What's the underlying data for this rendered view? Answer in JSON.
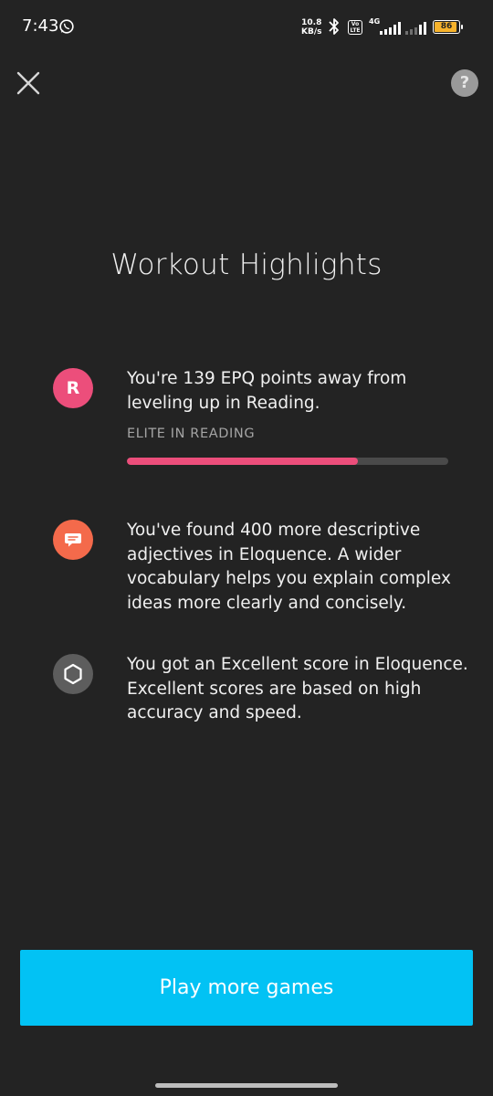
{
  "status_bar": {
    "time": "7:43",
    "net_speed_value": "10.8",
    "net_speed_unit": "KB/s",
    "network": "4G",
    "volte": "Vo LTE",
    "battery": "86",
    "icons": [
      "whatsapp-icon",
      "bluetooth-icon",
      "volte-icon",
      "signal-icon",
      "battery-icon"
    ]
  },
  "header": {
    "close_icon": "close-icon",
    "help_label": "?"
  },
  "page": {
    "title": "Workout Highlights"
  },
  "highlights": [
    {
      "icon": "letter-r",
      "badge_letter": "R",
      "badge_color": "#ec4e7b",
      "text": "You're 139 EPQ points away from leveling up in Reading.",
      "progress_label": "ELITE IN READING",
      "progress_fraction": 0.72,
      "progress_color": "#ec4e7b"
    },
    {
      "icon": "chat-icon",
      "badge_color": "#f46a4b",
      "text": "You've found 400 more descriptive adjectives in Eloquence. A wider vocabulary helps you explain complex ideas more clearly and concisely."
    },
    {
      "icon": "hexagon-icon",
      "badge_color": "#5d5d5d",
      "text": "You got an Excellent score in Eloquence. Excellent scores are based on high accuracy and speed."
    }
  ],
  "cta": {
    "label": "Play more games",
    "color": "#02c2f4"
  }
}
